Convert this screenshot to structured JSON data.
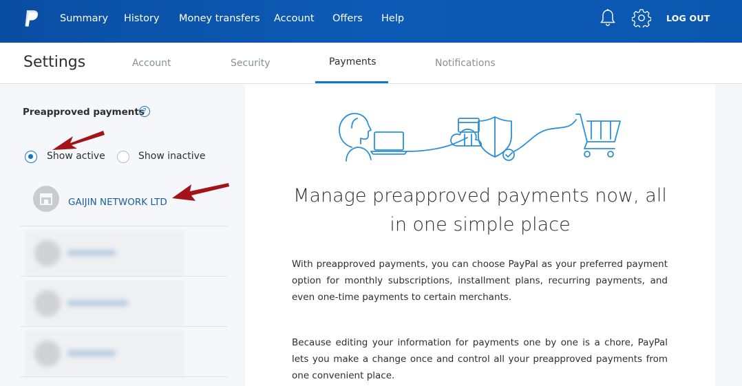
{
  "nav": {
    "items": [
      "Summary",
      "History",
      "Money transfers",
      "Account",
      "Offers",
      "Help"
    ],
    "logout": "LOG OUT",
    "brand_color": "#0b57b0"
  },
  "settings": {
    "title": "Settings",
    "tabs": [
      "Account",
      "Security",
      "Payments",
      "Notifications"
    ],
    "active_tab": "Payments"
  },
  "sidebar": {
    "title": "Preapproved payments",
    "filter_options": [
      "Show active",
      "Show inactive"
    ],
    "selected_filter": "Show active",
    "merchant": "GAIJIN NETWORK LTD"
  },
  "main": {
    "headline": "Manage preapproved payments now, all in one simple place",
    "paragraph1": "With preapproved payments, you can choose PayPal as your preferred payment option for monthly subscriptions, installment plans, recurring payments, and even one-time payments to certain merchants.",
    "paragraph2": "Because editing your information for payments one by one is a chore, PayPal lets you make a change once and control all your preapproved payments from one convenient place."
  },
  "colors": {
    "link": "#1b5e97",
    "accent": "#0c77c6",
    "annotation_arrow": "#a3141a"
  }
}
